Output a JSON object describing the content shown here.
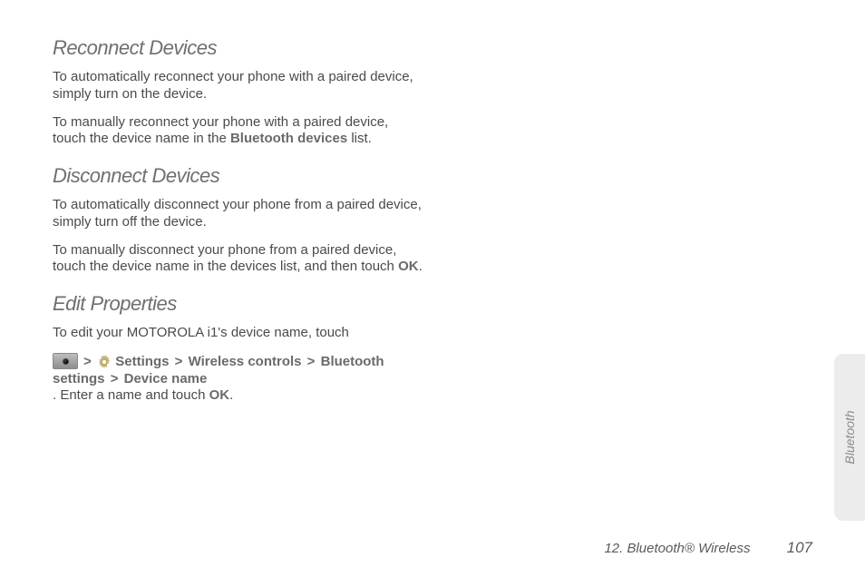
{
  "sections": {
    "reconnect": {
      "heading": "Reconnect Devices",
      "p1": "To automatically reconnect your phone with a paired device, simply turn on the device.",
      "p2a": "To manually reconnect your phone with a paired device, touch the device name in the ",
      "p2b": "Bluetooth devices",
      "p2c": " list."
    },
    "disconnect": {
      "heading": "Disconnect Devices",
      "p1": "To automatically disconnect your phone from a paired device, simply turn off the device.",
      "p2a": "To manually disconnect your phone from a paired device, touch the device name in the devices list, and then touch ",
      "p2b": "OK",
      "p2c": "."
    },
    "edit": {
      "heading": "Edit Properties",
      "p1": "To edit your MOTOROLA i1's device name, touch",
      "path": {
        "settings": "Settings",
        "wireless": "Wireless controls",
        "bt": "Bluetooth settings",
        "devname": "Device name"
      },
      "p2a": ". Enter a name and touch ",
      "p2b": "OK",
      "p2c": "."
    }
  },
  "side_tab": "Bluetooth",
  "footer": {
    "chapter": "12. Bluetooth® Wireless",
    "page": "107"
  },
  "glyph": {
    "gt": ">"
  }
}
